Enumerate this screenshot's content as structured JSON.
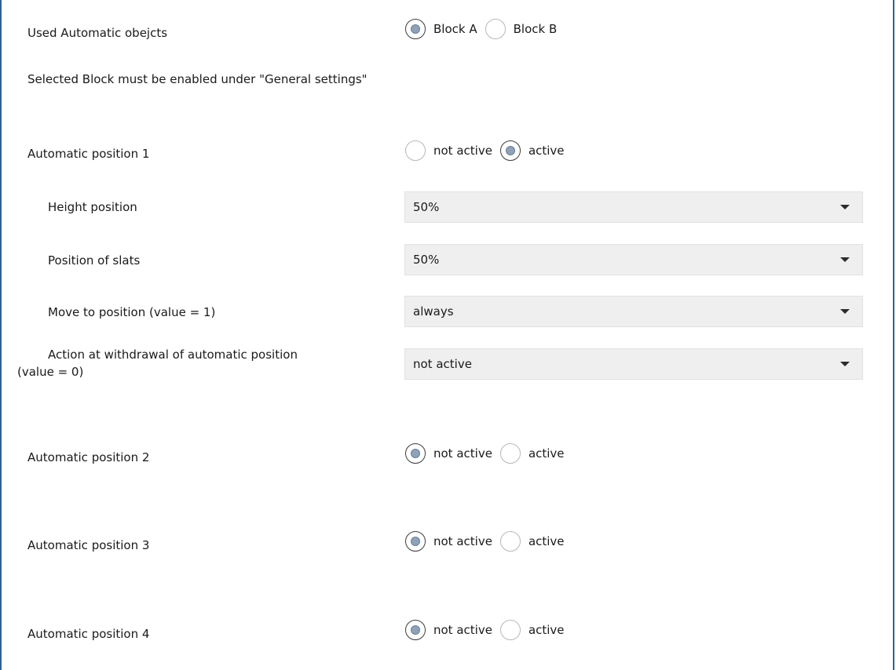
{
  "used_objects": {
    "label": "Used Automatic obejcts",
    "options": [
      "Block A",
      "Block B"
    ],
    "selected": "Block A"
  },
  "note": "Selected Block must be enabled under \"General settings\"",
  "position1": {
    "label": "Automatic position 1",
    "options": [
      "not active",
      "active"
    ],
    "selected": "active",
    "fields": {
      "height": {
        "label": "Height position",
        "value": "50%"
      },
      "slats": {
        "label": "Position of slats",
        "value": "50%"
      },
      "move": {
        "label": "Move to position (value = 1)",
        "value": "always"
      },
      "withdrawal": {
        "label_line1": "Action at withdrawal of automatic position",
        "label_line2": "(value = 0)",
        "value": "not active"
      }
    }
  },
  "position2": {
    "label": "Automatic position 2",
    "options": [
      "not active",
      "active"
    ],
    "selected": "not active"
  },
  "position3": {
    "label": "Automatic position 3",
    "options": [
      "not active",
      "active"
    ],
    "selected": "not active"
  },
  "position4": {
    "label": "Automatic position 4",
    "options": [
      "not active",
      "active"
    ],
    "selected": "not active"
  },
  "colors": {
    "frame_border": "#2f5f93",
    "select_bg": "#efefef",
    "radio_dot": "#8fa2b8"
  },
  "icons": {
    "dropdown": "chevron-down-icon",
    "radio_checked": "radio-checked-icon",
    "radio_unchecked": "radio-unchecked-icon"
  }
}
